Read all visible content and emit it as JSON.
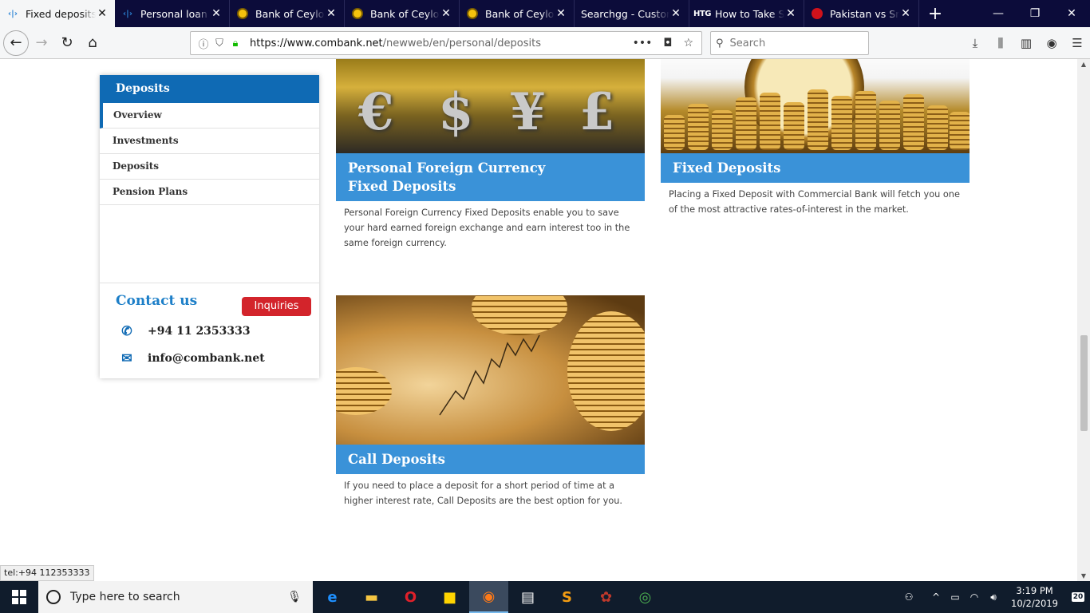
{
  "browser": {
    "tabs": [
      {
        "title": "Fixed deposits | Commercial Bank",
        "favicon": "cb"
      },
      {
        "title": "Personal loan | Commercial Bank",
        "favicon": "cb"
      },
      {
        "title": "Bank of Ceylon",
        "favicon": "boc"
      },
      {
        "title": "Bank of Ceylon",
        "favicon": "boc"
      },
      {
        "title": "Bank of Ceylon",
        "favicon": "boc"
      },
      {
        "title": "Searchgg - Customize",
        "favicon": "none"
      },
      {
        "title": "How to Take Screenshot",
        "favicon": "htg"
      },
      {
        "title": "Pakistan vs Sri Lanka",
        "favicon": "red"
      }
    ],
    "url_domain": "https://www.combank.net",
    "url_path": "/newweb/en/personal/deposits",
    "search_placeholder": "Search",
    "fav_cb": "‹|›",
    "fav_htg": "HTG"
  },
  "sidebar": {
    "header": "Deposits",
    "items": [
      "Overview",
      "Investments",
      "Deposits",
      "Pension Plans"
    ],
    "contact_title": "Contact us",
    "inquiries_label": "Inquiries",
    "phone": "+94 11 2353333",
    "email": "info@combank.net"
  },
  "cards": [
    {
      "title_line1": "Personal Foreign Currency",
      "title_line2": "Fixed Deposits",
      "description": "Personal Foreign Currency Fixed Deposits enable you to save your hard earned foreign exchange and earn interest too in the same foreign currency."
    },
    {
      "title": "Fixed Deposits",
      "description": "Placing a Fixed Deposit with Commercial Bank will fetch you one of the most attractive rates-of-interest in the market."
    },
    {
      "title": "Call Deposits",
      "description": "If you need to place a deposit for a short period of time at a higher interest rate, Call Deposits are the best option for you."
    }
  ],
  "fx_symbols": [
    "€",
    "$",
    "¥",
    "£"
  ],
  "status_tip": "tel:+94 112353333",
  "taskbar": {
    "search_placeholder": "Type here to search",
    "time": "3:19 PM",
    "date": "10/2/2019",
    "notification_count": "20"
  },
  "colors": {
    "brand_blue": "#0f6ab4",
    "banner_blue": "#3a92d8",
    "inquiries_red": "#d3242b"
  }
}
